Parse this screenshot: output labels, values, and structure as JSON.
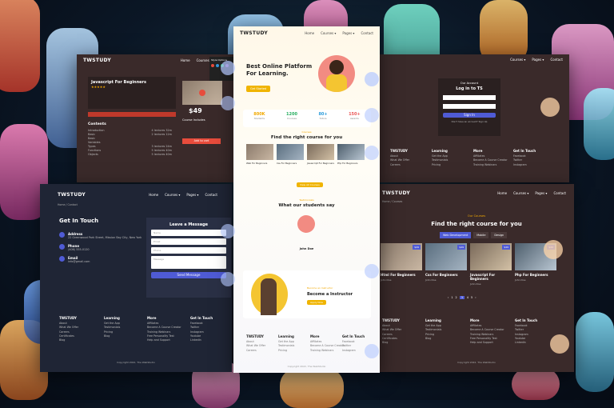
{
  "brand": "TWSTUDY",
  "nav": {
    "home": "Home",
    "courses": "Courses ▾",
    "pages": "Pages ▾",
    "contact": "Contact"
  },
  "detail": {
    "course_title": "Javascript For Beginners",
    "price": "$49",
    "enroll": "Add to cart",
    "contents_title": "Contents",
    "items": [
      {
        "label": "Introduction",
        "time": "4 lectures 32m"
      },
      {
        "label": "Basic",
        "time": "2 lectures 12m"
      },
      {
        "label": "Basic",
        "time": ""
      },
      {
        "label": "Variables",
        "time": ""
      },
      {
        "label": "Types",
        "time": "3 lectures 24m"
      },
      {
        "label": "Functions",
        "time": "5 lectures 40m"
      },
      {
        "label": "Objects",
        "time": "5 lectures 40m"
      }
    ],
    "includes": "Course Includes",
    "style_options": "Style Options"
  },
  "home": {
    "hero_line1": "Best Online Platform",
    "hero_line2": "For Learning.",
    "hero_cta": "Get Started",
    "stats": [
      {
        "value": "800K",
        "label": "Students",
        "color": "#f2a900"
      },
      {
        "value": "1200",
        "label": "Courses",
        "color": "#27ae60"
      },
      {
        "value": "80+",
        "label": "Tutors",
        "color": "#2d9cdb"
      },
      {
        "value": "150+",
        "label": "Awards",
        "color": "#eb5757"
      }
    ],
    "tagline": "Courses",
    "find_title": "Find the right course for you",
    "cards": [
      "Web For Beginners",
      "Css For Beginners",
      "Javascript For Beginners",
      "Php For Beginners"
    ],
    "view_all": "View All Courses",
    "testimonial_tag": "Testimonials",
    "testimonial_title": "What our students say",
    "testimonial_name": "John Doe",
    "instructor_tag": "Become an Instructor",
    "instructor_title": "Become a Instructor",
    "instructor_btn": "Apply Now",
    "copyright": "Copyright 2022, The WebStudio"
  },
  "login": {
    "title": "Our Account",
    "heading": "Log in to TS",
    "login_btn": "Sign In",
    "forgot": "Don't have an account? Sign Up"
  },
  "contact": {
    "breadcrumb": "Home  /  Contact",
    "title": "Get In Touch",
    "address_label": "Address",
    "address": "22 Greenwood Park Street, Mission Bay City, New York",
    "phone_label": "Phone",
    "phone": "(406) 555-0120",
    "email_label": "Email",
    "email": "info@gmail.com",
    "form_title": "Leave a Message",
    "name_ph": "Name",
    "email_ph": "Email",
    "phone_ph": "Phone",
    "message_ph": "Message",
    "send": "Send Message",
    "copyright": "Copyright 2022, The WebStudio"
  },
  "courses_page": {
    "breadcrumb": "Home  /  Courses",
    "tag": "Our Courses",
    "title": "Find the right course for you",
    "tabs": [
      "Web Development",
      "Mobile",
      "Design"
    ],
    "cards": [
      {
        "title": "Html For Beginners",
        "price": "$49"
      },
      {
        "title": "Css For Beginners",
        "price": "$49"
      },
      {
        "title": "Javascript For Beginners",
        "price": "$49"
      },
      {
        "title": "Php For Beginners",
        "price": "$49"
      }
    ],
    "author": "John Doe",
    "pages": [
      "‹",
      "1",
      "2",
      "3",
      "4",
      "5",
      "›"
    ],
    "copyright": "Copyright 2022, The WebStudio"
  },
  "footer": {
    "col1": [
      "About",
      "What We Offer",
      "Careers",
      "Certificates",
      "Blog"
    ],
    "learning_title": "Learning",
    "col2": [
      "Get the App",
      "Testimonials",
      "Pricing",
      "Blog"
    ],
    "more_title": "More",
    "col3": [
      "Affiliates",
      "Become A Course Creator",
      "Training Webinars",
      "Free Personality Test",
      "Help and Support"
    ],
    "touch_title": "Get In Touch",
    "col4": [
      "Facebook",
      "Twitter",
      "Instagram",
      "Youtube",
      "Linkedin"
    ]
  }
}
